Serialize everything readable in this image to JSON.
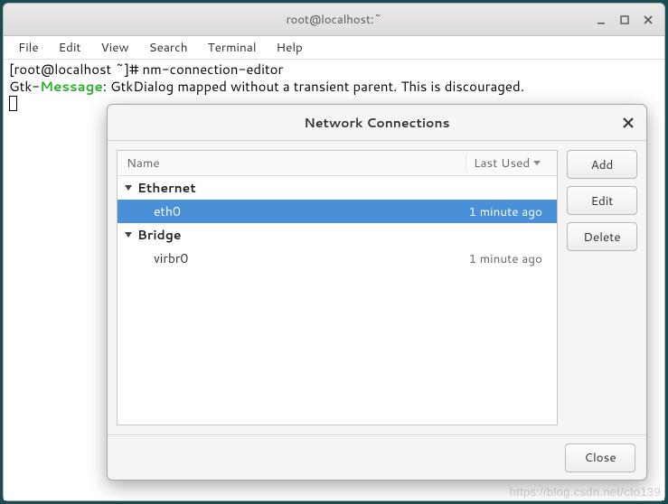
{
  "window": {
    "title": "root@localhost:~",
    "menubar": [
      "File",
      "Edit",
      "View",
      "Search",
      "Terminal",
      "Help"
    ]
  },
  "terminal": {
    "prompt": "[root@localhost ~]# ",
    "command": "nm-connection-editor",
    "msg_prefix": "Gtk-",
    "msg_highlight": "Message",
    "msg_rest": ": GtkDialog mapped without a transient parent. This is discouraged."
  },
  "dialog": {
    "title": "Network Connections",
    "columns": {
      "name": "Name",
      "last_used": "Last Used"
    },
    "groups": [
      {
        "label": "Ethernet",
        "items": [
          {
            "name": "eth0",
            "last_used": "1 minute ago",
            "selected": true
          }
        ]
      },
      {
        "label": "Bridge",
        "items": [
          {
            "name": "virbr0",
            "last_used": "1 minute ago",
            "selected": false
          }
        ]
      }
    ],
    "buttons": {
      "add": "Add",
      "edit": "Edit",
      "delete": "Delete",
      "close": "Close"
    }
  },
  "watermark": "https://blog.csdn.net/cto139"
}
